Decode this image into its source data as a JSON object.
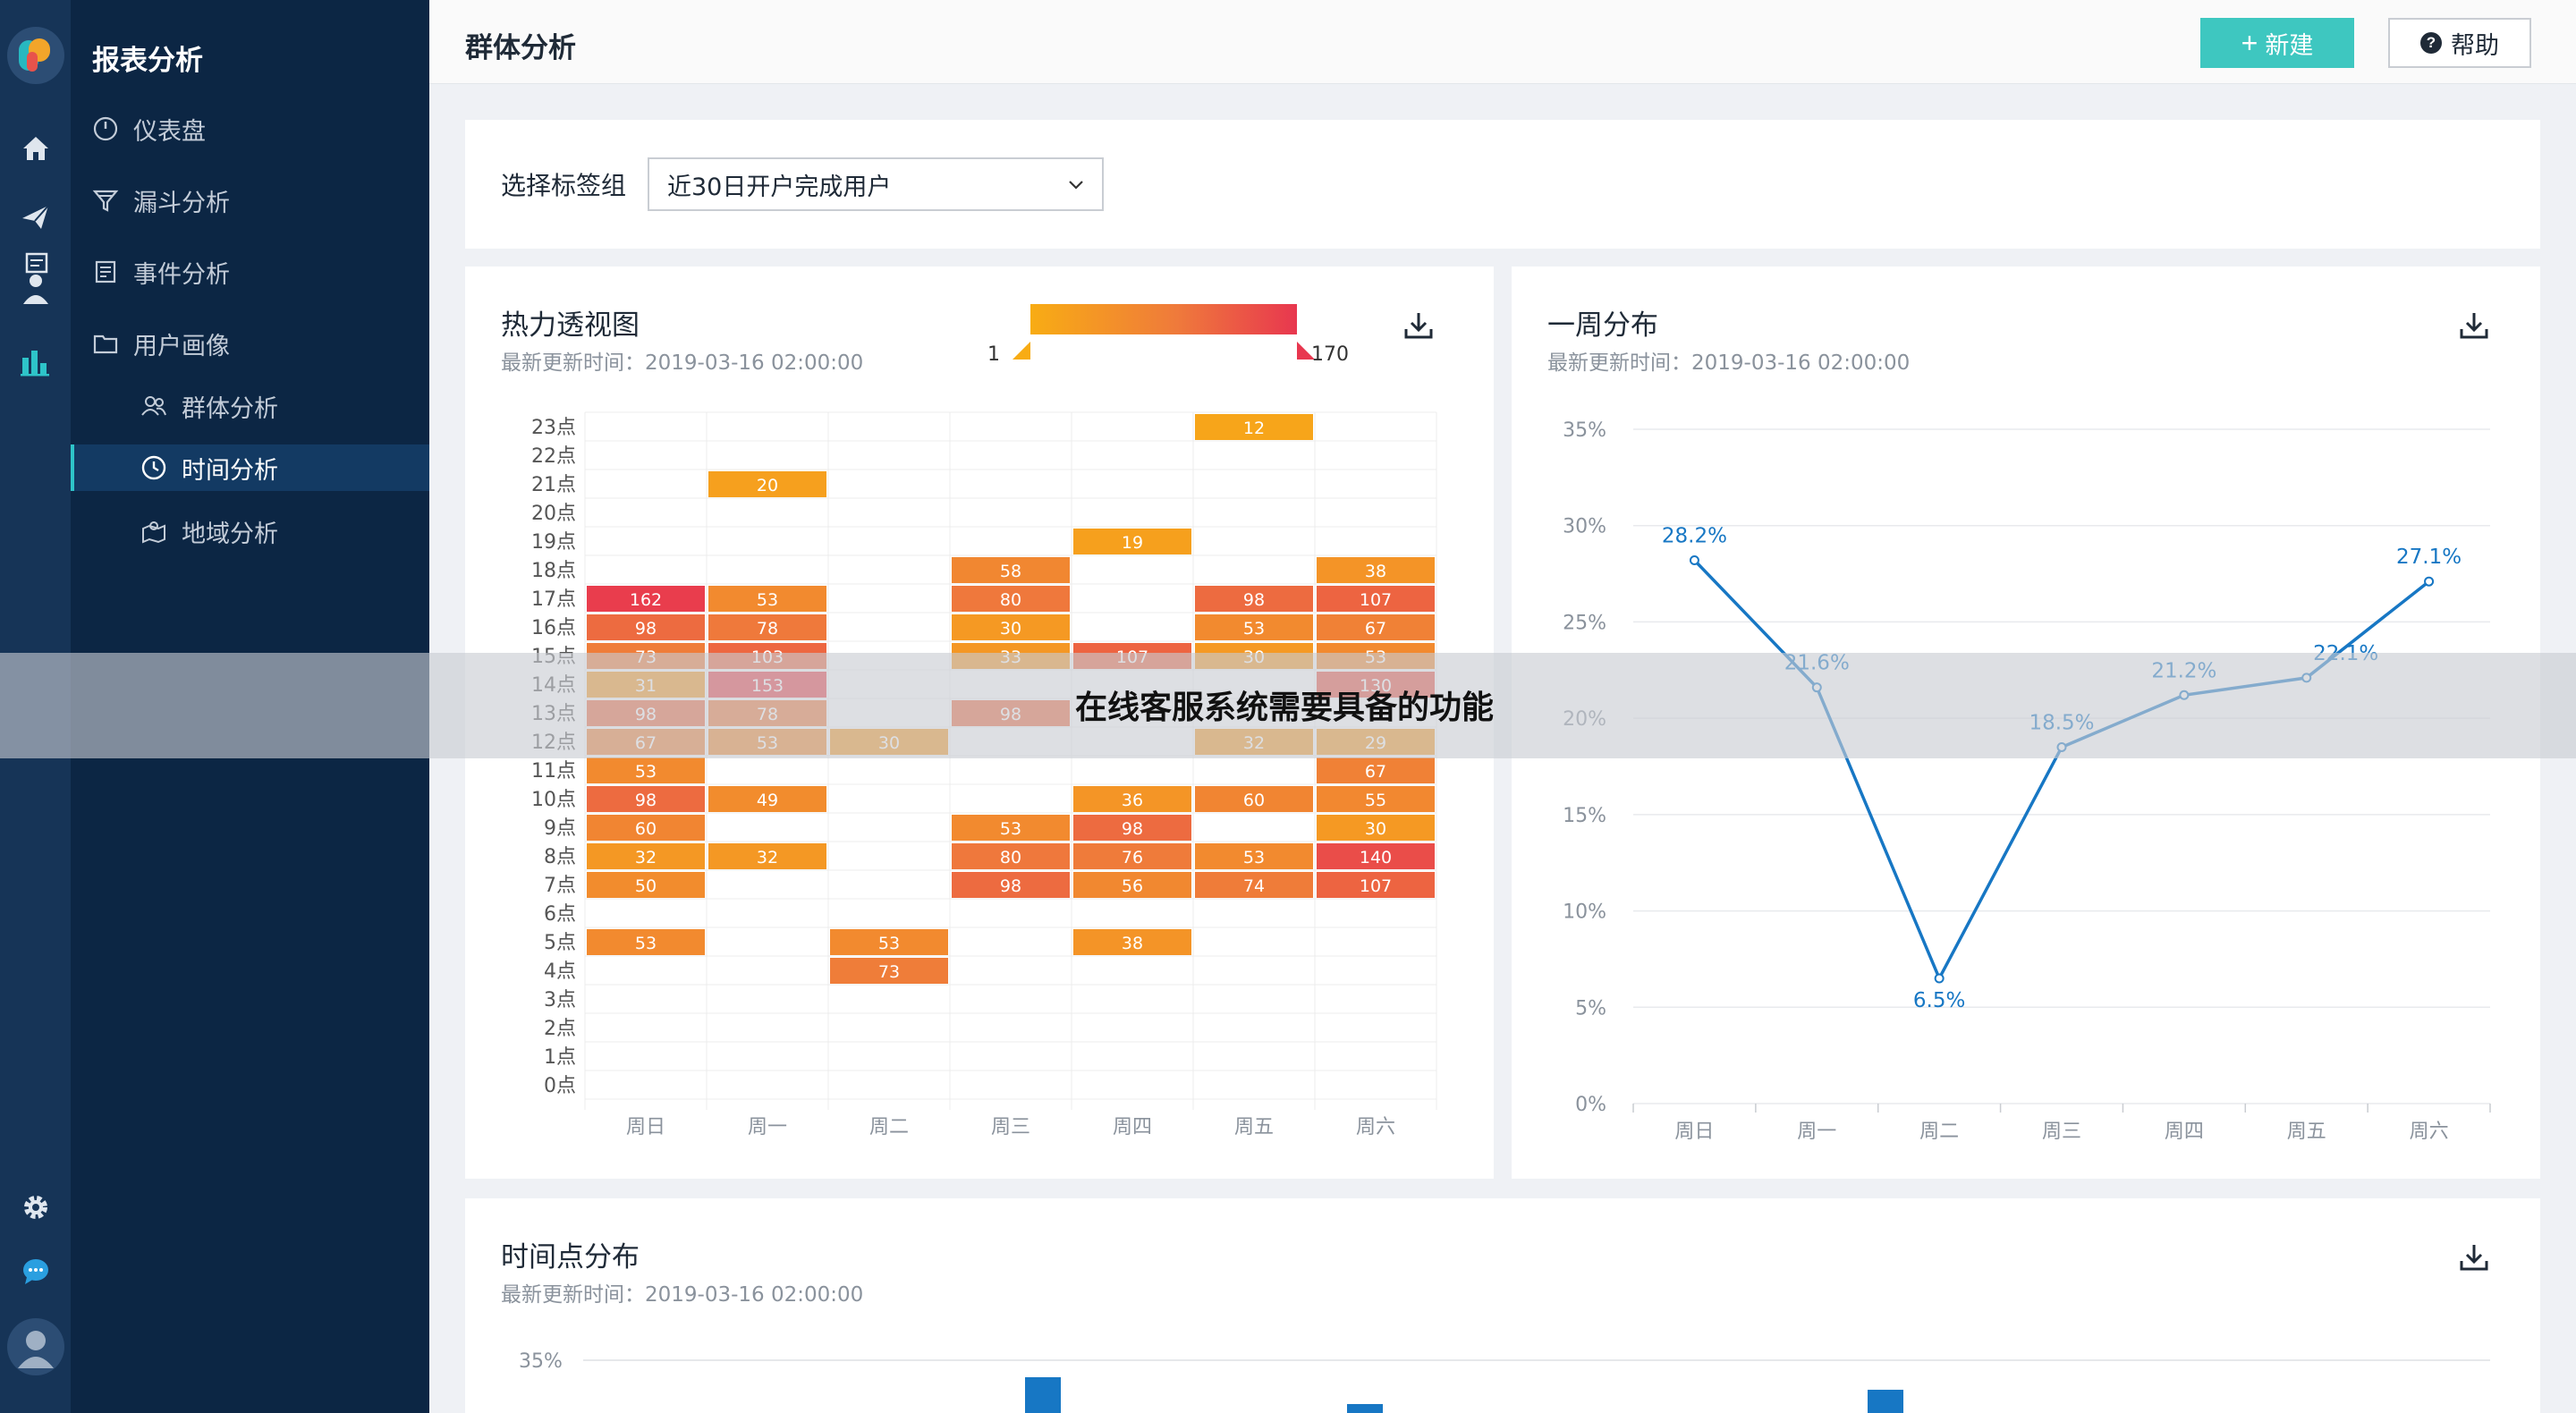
{
  "app": {
    "name": "报表分析"
  },
  "nav": {
    "items": [
      {
        "label": "仪表盘",
        "icon": "gauge-icon"
      },
      {
        "label": "漏斗分析",
        "icon": "funnel-icon"
      },
      {
        "label": "事件分析",
        "icon": "document-icon"
      },
      {
        "label": "用户画像",
        "icon": "folder-icon"
      },
      {
        "label": "群体分析",
        "icon": "group-icon"
      },
      {
        "label": "时间分析",
        "icon": "clock-icon",
        "active": true
      },
      {
        "label": "地域分析",
        "icon": "map-icon"
      }
    ]
  },
  "rail": {
    "icons": [
      "home-icon",
      "send-icon",
      "user-report-icon",
      "bar-chart-icon",
      "gear-icon",
      "chat-icon",
      "user-avatar-icon"
    ],
    "accent": "#2ec4c9"
  },
  "header": {
    "title": "群体分析",
    "new_label": "新建",
    "help_label": "帮助"
  },
  "filter": {
    "label": "选择标签组",
    "value": "近30日开户完成用户"
  },
  "heatmap_card": {
    "title": "热力透视图",
    "updated": "最新更新时间：2019-03-16 02:00:00",
    "legend_min": "1",
    "legend_max": "170"
  },
  "weekly_card": {
    "title": "一周分布",
    "updated": "最新更新时间：2019-03-16 02:00:00"
  },
  "hourly_card": {
    "title": "时间点分布",
    "updated": "最新更新时间：2019-03-16 02:00:00"
  },
  "overlay_text": "在线客服系统需要具备的功能",
  "chart_data": [
    {
      "type": "heatmap",
      "title": "热力透视图",
      "x_categories": [
        "周日",
        "周一",
        "周二",
        "周三",
        "周四",
        "周五",
        "周六"
      ],
      "y_categories": [
        "0点",
        "1点",
        "2点",
        "3点",
        "4点",
        "5点",
        "6点",
        "7点",
        "8点",
        "9点",
        "10点",
        "11点",
        "12点",
        "13点",
        "14点",
        "15点",
        "16点",
        "17点",
        "18点",
        "19点",
        "20点",
        "21点",
        "22点",
        "23点"
      ],
      "cells": [
        {
          "day": 5,
          "hour": 23,
          "value": 12
        },
        {
          "day": 1,
          "hour": 21,
          "value": 20
        },
        {
          "day": 4,
          "hour": 19,
          "value": 19
        },
        {
          "day": 3,
          "hour": 18,
          "value": 58
        },
        {
          "day": 6,
          "hour": 18,
          "value": 38
        },
        {
          "day": 0,
          "hour": 17,
          "value": 162
        },
        {
          "day": 1,
          "hour": 17,
          "value": 53
        },
        {
          "day": 3,
          "hour": 17,
          "value": 80
        },
        {
          "day": 5,
          "hour": 17,
          "value": 98
        },
        {
          "day": 6,
          "hour": 17,
          "value": 107
        },
        {
          "day": 0,
          "hour": 16,
          "value": 98
        },
        {
          "day": 1,
          "hour": 16,
          "value": 78
        },
        {
          "day": 3,
          "hour": 16,
          "value": 30
        },
        {
          "day": 5,
          "hour": 16,
          "value": 53
        },
        {
          "day": 6,
          "hour": 16,
          "value": 67
        },
        {
          "day": 0,
          "hour": 15,
          "value": 73
        },
        {
          "day": 1,
          "hour": 15,
          "value": 103
        },
        {
          "day": 3,
          "hour": 15,
          "value": 33
        },
        {
          "day": 4,
          "hour": 15,
          "value": 107
        },
        {
          "day": 5,
          "hour": 15,
          "value": 30
        },
        {
          "day": 6,
          "hour": 15,
          "value": 53
        },
        {
          "day": 0,
          "hour": 14,
          "value": 31
        },
        {
          "day": 1,
          "hour": 14,
          "value": 153
        },
        {
          "day": 6,
          "hour": 14,
          "value": 130
        },
        {
          "day": 0,
          "hour": 13,
          "value": 98
        },
        {
          "day": 1,
          "hour": 13,
          "value": 78
        },
        {
          "day": 3,
          "hour": 13,
          "value": 98
        },
        {
          "day": 0,
          "hour": 12,
          "value": 67
        },
        {
          "day": 1,
          "hour": 12,
          "value": 53
        },
        {
          "day": 2,
          "hour": 12,
          "value": 30
        },
        {
          "day": 5,
          "hour": 12,
          "value": 32
        },
        {
          "day": 6,
          "hour": 12,
          "value": 29
        },
        {
          "day": 0,
          "hour": 11,
          "value": 53
        },
        {
          "day": 6,
          "hour": 11,
          "value": 67
        },
        {
          "day": 0,
          "hour": 10,
          "value": 98
        },
        {
          "day": 1,
          "hour": 10,
          "value": 49
        },
        {
          "day": 4,
          "hour": 10,
          "value": 36
        },
        {
          "day": 5,
          "hour": 10,
          "value": 60
        },
        {
          "day": 6,
          "hour": 10,
          "value": 55
        },
        {
          "day": 0,
          "hour": 9,
          "value": 60
        },
        {
          "day": 3,
          "hour": 9,
          "value": 53
        },
        {
          "day": 4,
          "hour": 9,
          "value": 98
        },
        {
          "day": 6,
          "hour": 9,
          "value": 30
        },
        {
          "day": 0,
          "hour": 8,
          "value": 32
        },
        {
          "day": 1,
          "hour": 8,
          "value": 32
        },
        {
          "day": 3,
          "hour": 8,
          "value": 80
        },
        {
          "day": 4,
          "hour": 8,
          "value": 76
        },
        {
          "day": 5,
          "hour": 8,
          "value": 53
        },
        {
          "day": 6,
          "hour": 8,
          "value": 140
        },
        {
          "day": 0,
          "hour": 7,
          "value": 50
        },
        {
          "day": 3,
          "hour": 7,
          "value": 98
        },
        {
          "day": 4,
          "hour": 7,
          "value": 56
        },
        {
          "day": 5,
          "hour": 7,
          "value": 74
        },
        {
          "day": 6,
          "hour": 7,
          "value": 107
        },
        {
          "day": 0,
          "hour": 5,
          "value": 53
        },
        {
          "day": 2,
          "hour": 5,
          "value": 53
        },
        {
          "day": 4,
          "hour": 5,
          "value": 38
        },
        {
          "day": 2,
          "hour": 4,
          "value": 73
        }
      ],
      "legend_range": [
        1,
        170
      ],
      "colors": {
        "low": "#f8ac14",
        "mid": "#ef7a3b",
        "high": "#e8374f"
      }
    },
    {
      "type": "line",
      "title": "一周分布",
      "categories": [
        "周日",
        "周一",
        "周二",
        "周三",
        "周四",
        "周五",
        "周六"
      ],
      "values": [
        28.2,
        21.6,
        6.5,
        18.5,
        21.2,
        22.1,
        27.1
      ],
      "labels": [
        "28.2%",
        "21.6%",
        "6.5%",
        "18.5%",
        "21.2%",
        "22.1%",
        "27.1%"
      ],
      "ylim": [
        0,
        35
      ],
      "yticks": [
        "0%",
        "5%",
        "10%",
        "15%",
        "20%",
        "25%",
        "30%",
        "35%"
      ],
      "grid": true,
      "color": "#1777c4"
    },
    {
      "type": "bar",
      "title": "时间点分布",
      "ylim": [
        0,
        35
      ],
      "yticks": [
        "35%"
      ],
      "color": "#1777c4"
    }
  ]
}
